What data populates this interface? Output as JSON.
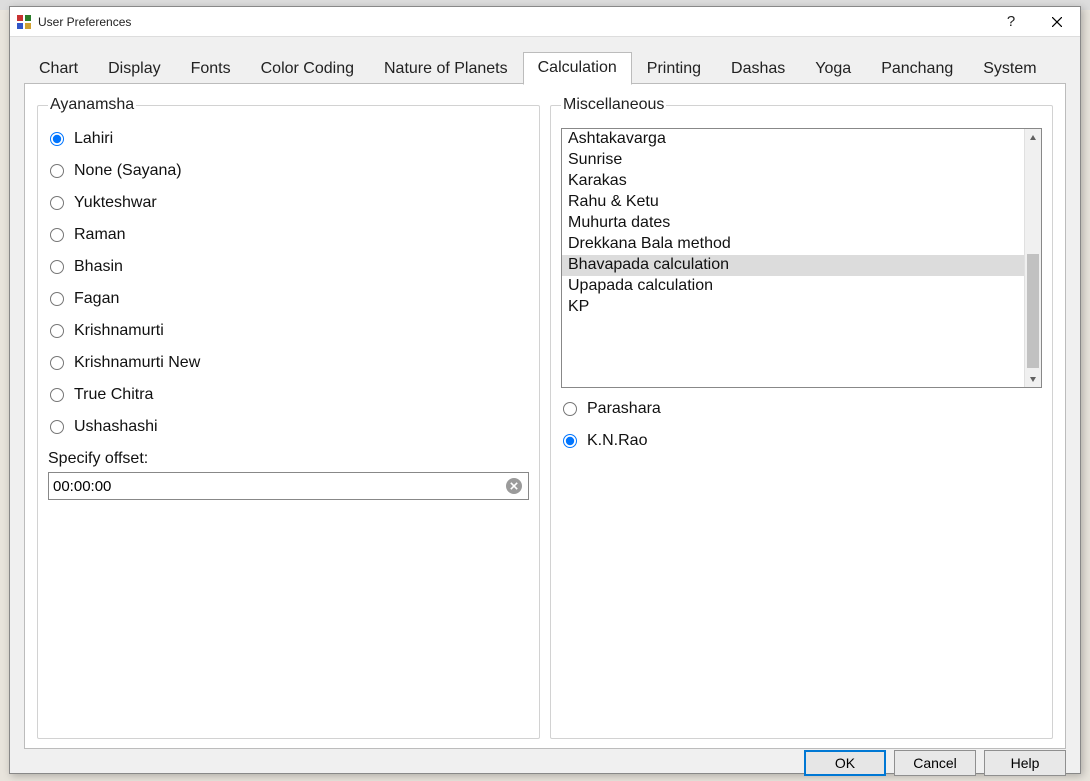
{
  "window": {
    "title": "User Preferences"
  },
  "tabs": [
    {
      "label": "Chart"
    },
    {
      "label": "Display"
    },
    {
      "label": "Fonts"
    },
    {
      "label": "Color Coding"
    },
    {
      "label": "Nature of Planets"
    },
    {
      "label": "Calculation"
    },
    {
      "label": "Printing"
    },
    {
      "label": "Dashas"
    },
    {
      "label": "Yoga"
    },
    {
      "label": "Panchang"
    },
    {
      "label": "System"
    }
  ],
  "groups": {
    "ayanamsha": {
      "legend": "Ayanamsha"
    },
    "misc": {
      "legend": "Miscellaneous"
    }
  },
  "ayanamsha_options": [
    "Lahiri",
    "None (Sayana)",
    "Yukteshwar",
    "Raman",
    "Bhasin",
    "Fagan",
    "Krishnamurti",
    "Krishnamurti New",
    "True Chitra",
    "Ushashashi"
  ],
  "ayanamsha_selected": "Lahiri",
  "offset": {
    "label": "Specify offset:",
    "value": "00:00:00"
  },
  "misc_items": [
    "Ashtakavarga",
    "Sunrise",
    "Karakas",
    "Rahu & Ketu",
    "Muhurta dates",
    "Drekkana Bala method",
    "Bhavapada calculation",
    "Upapada calculation",
    "KP"
  ],
  "misc_selected": "Bhavapada calculation",
  "misc_sub_options": [
    "Parashara",
    "K.N.Rao"
  ],
  "misc_sub_selected": "K.N.Rao",
  "buttons": {
    "ok": "OK",
    "cancel": "Cancel",
    "help": "Help"
  }
}
